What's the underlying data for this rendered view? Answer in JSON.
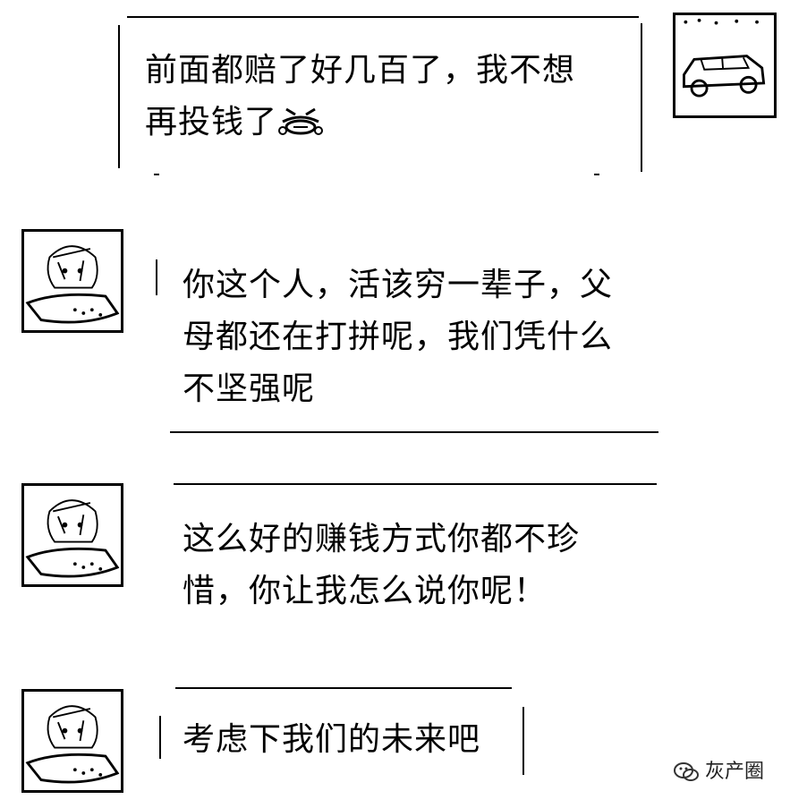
{
  "messages": [
    {
      "side": "right",
      "lines": [
        "前面都赔了好几百了，我不想",
        "再投钱了"
      ],
      "has_emoji": true,
      "emoji": "sob-emoji"
    },
    {
      "side": "left",
      "lines": [
        "你这个人，活该穷一辈子，父",
        "母都还在打拼呢，我们凭什么",
        "不坚强呢"
      ]
    },
    {
      "side": "left",
      "lines": [
        "这么好的赚钱方式你都不珍",
        "惜，你让我怎么说你呢！"
      ]
    },
    {
      "side": "left",
      "lines": [
        "考虑下我们的未来吧"
      ]
    }
  ],
  "watermark": {
    "text": "灰产圈",
    "icon": "wechat-icon"
  }
}
